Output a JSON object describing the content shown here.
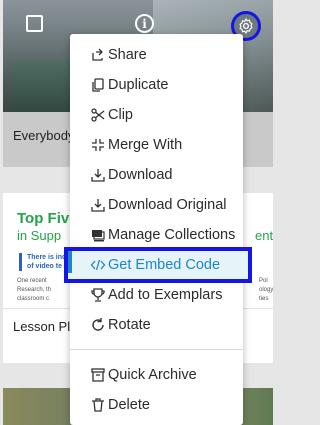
{
  "cards": [
    {
      "title": "Everybody"
    },
    {
      "title": "Lesson Pla",
      "doc": {
        "heading": "Top Five",
        "subheading": "in Supp",
        "right_heading": "ent",
        "highlight_lines": [
          "There is ind",
          "of video te"
        ],
        "body_lines": [
          "One recent",
          "Research, th",
          "classroom c"
        ],
        "right_lines": [
          "Pol",
          "ology",
          "ties"
        ]
      }
    },
    {
      "title": ""
    }
  ],
  "card_controls": {
    "info_glyph": "i",
    "icons": [
      "checkbox-icon",
      "info-icon",
      "gear-icon"
    ]
  },
  "menu": {
    "items": [
      {
        "label": "Share",
        "icon": "share-icon"
      },
      {
        "label": "Duplicate",
        "icon": "duplicate-icon"
      },
      {
        "label": "Clip",
        "icon": "scissors-icon"
      },
      {
        "label": "Merge With",
        "icon": "merge-icon"
      },
      {
        "label": "Download",
        "icon": "download-icon"
      },
      {
        "label": "Download Original",
        "icon": "download-icon"
      },
      {
        "label": "Manage Collections",
        "icon": "collections-icon"
      },
      {
        "label": "Get Embed Code",
        "icon": "code-icon",
        "active": true
      },
      {
        "label": "Add to Exemplars",
        "icon": "trophy-icon"
      },
      {
        "label": "Rotate",
        "icon": "rotate-icon"
      },
      {
        "label": "Quick Archive",
        "icon": "archive-icon"
      },
      {
        "label": "Delete",
        "icon": "trash-icon"
      }
    ]
  },
  "colors": {
    "highlight_border": "#1515e6",
    "active_text": "#1c86c7",
    "active_bg": "#e6f4fa",
    "doc_heading": "#23a349"
  }
}
